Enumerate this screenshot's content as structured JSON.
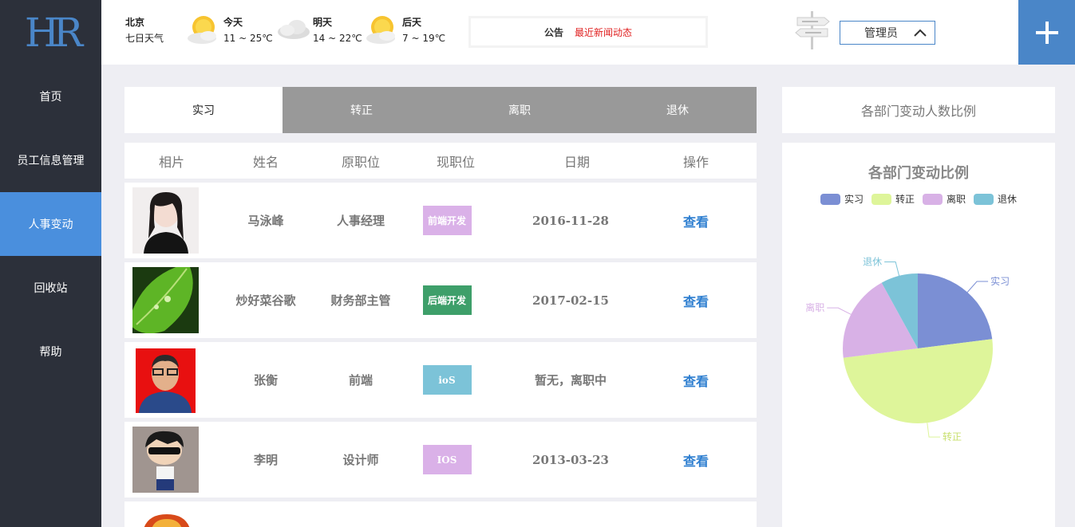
{
  "logo": "HR",
  "sidebar": {
    "items": [
      {
        "label": "首页"
      },
      {
        "label": "员工信息管理"
      },
      {
        "label": "人事变动"
      },
      {
        "label": "回收站"
      },
      {
        "label": "帮助"
      }
    ]
  },
  "weather": {
    "city": "北京",
    "subtitle": "七日天气",
    "days": [
      {
        "name": "今天",
        "temp": "11 ~ 25℃",
        "icon": "sunny-cloud-icon"
      },
      {
        "name": "明天",
        "temp": "14 ~ 22℃",
        "icon": "cloudy-icon"
      },
      {
        "name": "后天",
        "temp": "7 ~ 19℃",
        "icon": "sunny-cloud-icon"
      }
    ]
  },
  "notice": {
    "label": "公告",
    "text": "最近新闻动态"
  },
  "user": {
    "role": "管理员"
  },
  "tabs": [
    {
      "label": "实习"
    },
    {
      "label": "转正"
    },
    {
      "label": "离职"
    },
    {
      "label": "退休"
    }
  ],
  "table": {
    "headers": [
      "相片",
      "姓名",
      "原职位",
      "现职位",
      "日期",
      "操作"
    ],
    "rows": [
      {
        "name": "马泳峰",
        "old": "人事经理",
        "new": "前端开发",
        "badge_color": "#dab1e8",
        "date": "2016-11-28",
        "action": "查看"
      },
      {
        "name": "炒好菜谷歌",
        "old": "财务部主管",
        "new": "后端开发",
        "badge_color": "#3e9f6a",
        "date": "2017-02-15",
        "action": "查看"
      },
      {
        "name": "张衡",
        "old": "前端",
        "new": "ioS",
        "badge_color": "#7cc3d8",
        "date": "暂无，离职中",
        "action": "查看"
      },
      {
        "name": "李明",
        "old": "设计师",
        "new": "IOS",
        "badge_color": "#dab1e8",
        "date": "2013-03-23",
        "action": "查看"
      }
    ]
  },
  "right_panel": {
    "title": "各部门变动人数比例"
  },
  "chart_data": {
    "type": "pie",
    "title": "各部门变动比例",
    "categories": [
      "实习",
      "转正",
      "离职",
      "退休"
    ],
    "values": [
      23,
      50,
      19,
      8
    ],
    "colors": [
      "#7b8fd4",
      "#def59a",
      "#d8b1e6",
      "#7cc3d8"
    ],
    "legend": "top"
  }
}
